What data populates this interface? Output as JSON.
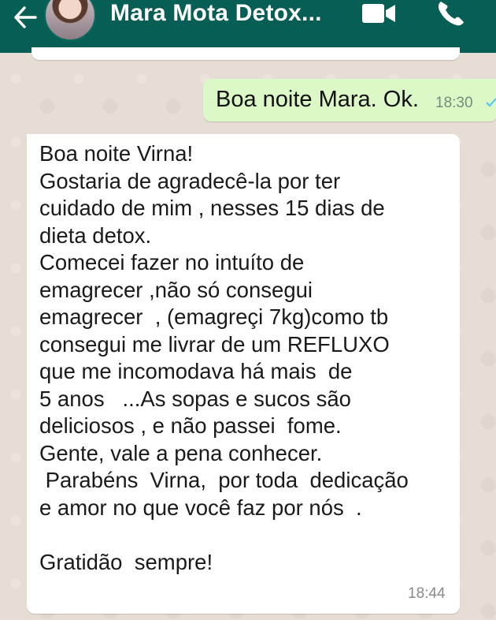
{
  "header": {
    "contact_name": "Mara Mota Detox...",
    "back_icon": "arrow-left-icon",
    "avatar": "contact-avatar",
    "video_icon": "video-call-icon",
    "call_icon": "phone-icon",
    "background_color": "#075e54"
  },
  "messages": {
    "outgoing": {
      "text": "Boa noite Mara. Ok.",
      "time": "18:30",
      "status_icon": "check-icon",
      "bubble_color": "#dcf8c6"
    },
    "incoming": {
      "lines": [
        "Boa noite Virna!",
        "Gostaria de agradecê-la por ter",
        "cuidado de mim , nesses 15 dias de",
        "dieta detox.",
        "Comecei fazer no intuíto de",
        "emagrecer ,não só consegui",
        "emagrecer  , (emagreçi 7kg)como tb",
        "consegui me livrar de um REFLUXO",
        "que me incomodava há mais  de",
        "5 anos   ...As sopas e sucos são",
        "deliciosos , e não passei  fome.",
        "Gente, vale a pena conhecer.",
        " Parabéns  Virna,  por toda  dedicação",
        "e amor no que você faz por nós  .",
        "",
        "Gratidão  sempre!"
      ],
      "time": "18:44",
      "bubble_color": "#ffffff"
    }
  }
}
